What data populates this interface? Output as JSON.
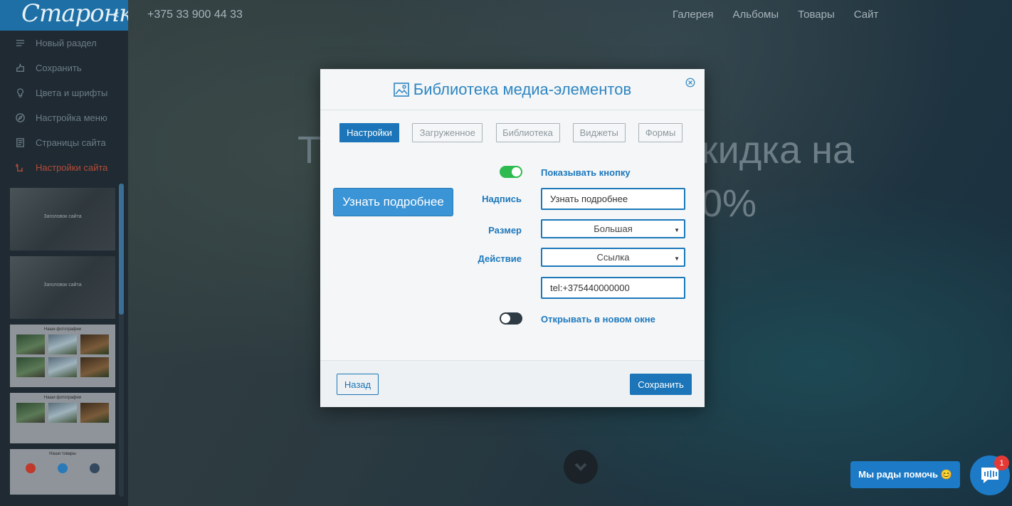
{
  "sidebar": {
    "logo": "Старонка",
    "collapse_icon": "«",
    "menu": [
      {
        "label": "Новый раздел",
        "icon": "add-section-icon"
      },
      {
        "label": "Сохранить",
        "icon": "save-icon"
      },
      {
        "label": "Цвета и шрифты",
        "icon": "palette-icon"
      },
      {
        "label": "Настройка меню",
        "icon": "compass-icon"
      },
      {
        "label": "Страницы сайта",
        "icon": "pages-icon"
      },
      {
        "label": "Настройки сайта",
        "icon": "settings-icon"
      }
    ],
    "thumbs": [
      {
        "caption": "Заголовок сайта"
      },
      {
        "caption": "Заголовок сайта"
      },
      {
        "caption": "Наши фотографии"
      },
      {
        "caption": "Наши фотографии"
      },
      {
        "caption": "Наши товары"
      }
    ]
  },
  "page": {
    "phone": "+375 33 900 44 33",
    "nav": [
      "Галерея",
      "Альбомы",
      "Товары",
      "Сайт"
    ],
    "hero_left": "Т",
    "hero_right": "кидка на",
    "hero_second": "0%"
  },
  "modal": {
    "title": "Библиотека медиа-элементов",
    "tabs": [
      "Настройки",
      "Загруженное",
      "Библиотека",
      "Виджеты",
      "Формы"
    ],
    "active_tab": "Настройки",
    "preview_button": "Узнать подробнее",
    "show_button_label": "Показывать кнопку",
    "show_button_on": true,
    "caption_label": "Надпись",
    "caption_value": "Узнать подробнее",
    "size_label": "Размер",
    "size_value": "Большая",
    "action_label": "Действие",
    "action_value": "Ссылка",
    "link_value": "tel:+375440000000",
    "new_window_label": "Открывать в новом окне",
    "new_window_on": false,
    "back": "Назад",
    "save": "Сохранить"
  },
  "chat": {
    "bubble": "Мы рады помочь 😊",
    "count": "1"
  },
  "colors": {
    "accent": "#1b75b8",
    "toggle_on": "#2dbb4f",
    "danger": "#b44c3a"
  }
}
